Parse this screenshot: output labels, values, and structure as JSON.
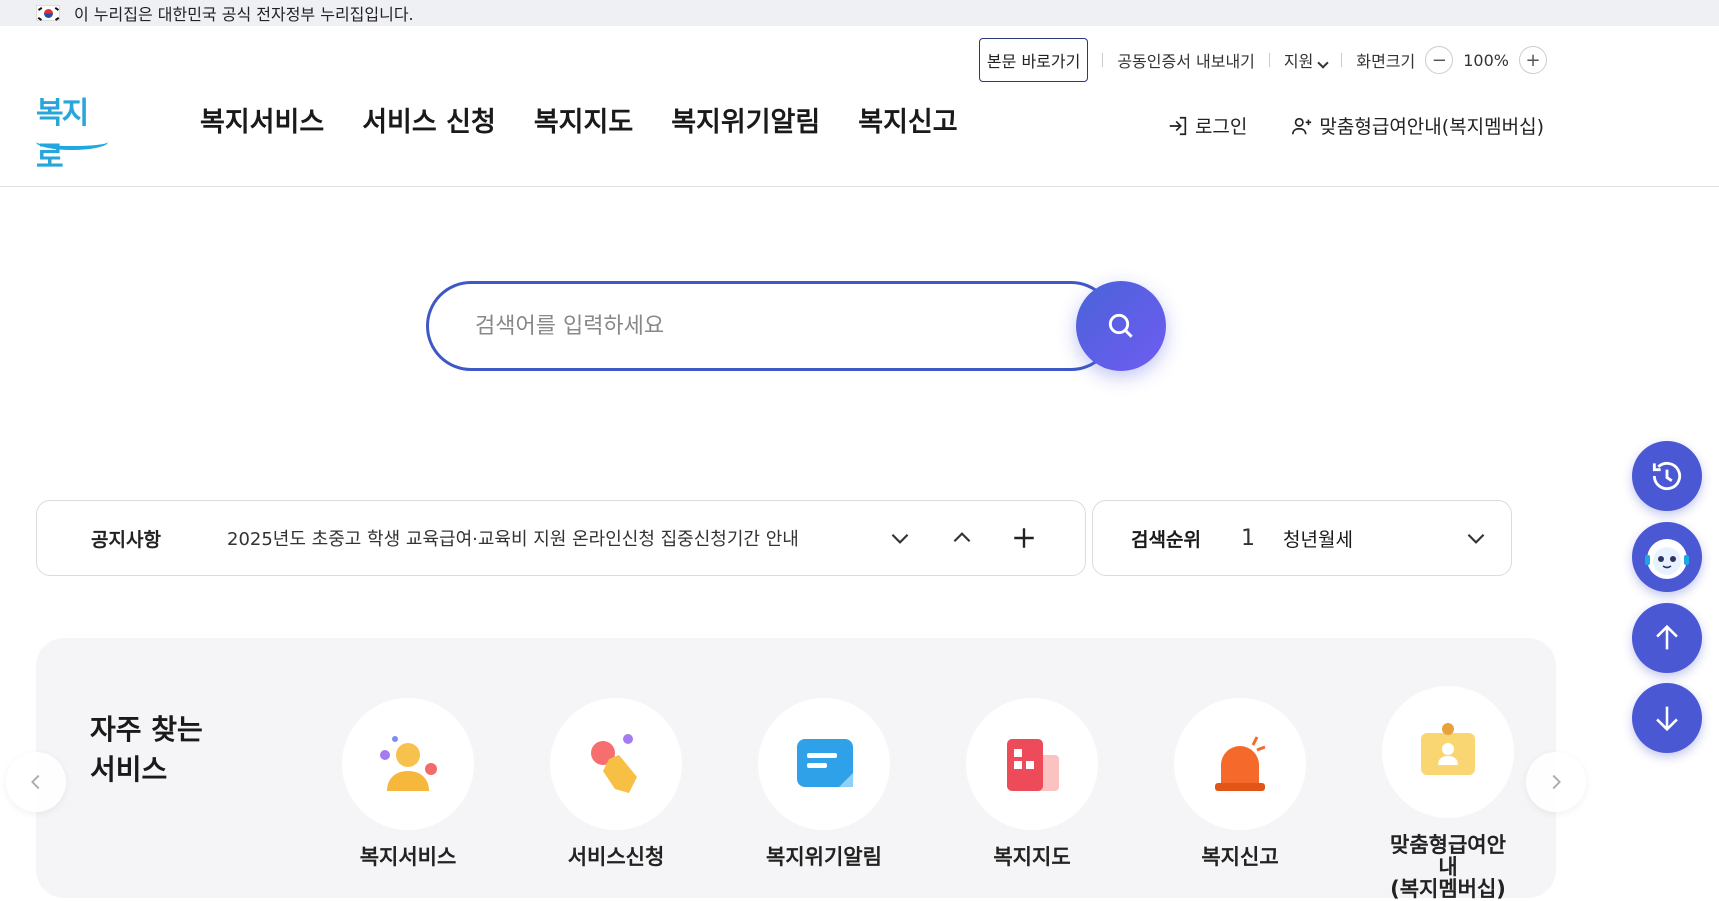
{
  "gov_banner": {
    "text": "이 누리집은 대한민국 공식 전자정부 누리집입니다."
  },
  "utility": {
    "skip": "본문 바로가기",
    "cert": "공동인증서 내보내기",
    "support": "지원",
    "zoom_label": "화면크기",
    "zoom_minus": "−",
    "zoom_value": "100%",
    "zoom_plus": "+"
  },
  "logo": {
    "text": "복지로"
  },
  "nav": [
    "복지서비스",
    "서비스 신청",
    "복지지도",
    "복지위기알림",
    "복지신고"
  ],
  "account": {
    "login": "로그인",
    "membership": "맞춤형급여안내(복지멤버십)"
  },
  "search": {
    "placeholder": "검색어를 입력하세요"
  },
  "notice": {
    "label": "공지사항",
    "text": "2025년도 초중고 학생 교육급여·교육비 지원 온라인신청 집중신청기간 안내"
  },
  "rank": {
    "label": "검색순위",
    "number": "1",
    "term": "청년월세"
  },
  "frequent": {
    "title_line1": "자주 찾는",
    "title_line2": "서비스",
    "items": [
      {
        "name": "복지서비스",
        "icon": "person-icon"
      },
      {
        "name": "서비스신청",
        "icon": "hand-tap-icon"
      },
      {
        "name": "복지위기알림",
        "icon": "message-icon"
      },
      {
        "name": "복지지도",
        "icon": "building-icon"
      },
      {
        "name": "복지신고",
        "icon": "siren-icon"
      },
      {
        "name": "맞춤형급여안내",
        "name2": "(복지멤버십)",
        "icon": "id-card-icon"
      }
    ]
  },
  "colors": {
    "accent": "#4a58d4",
    "search_border": "#3e58c6",
    "logo": "#29a6d9"
  }
}
